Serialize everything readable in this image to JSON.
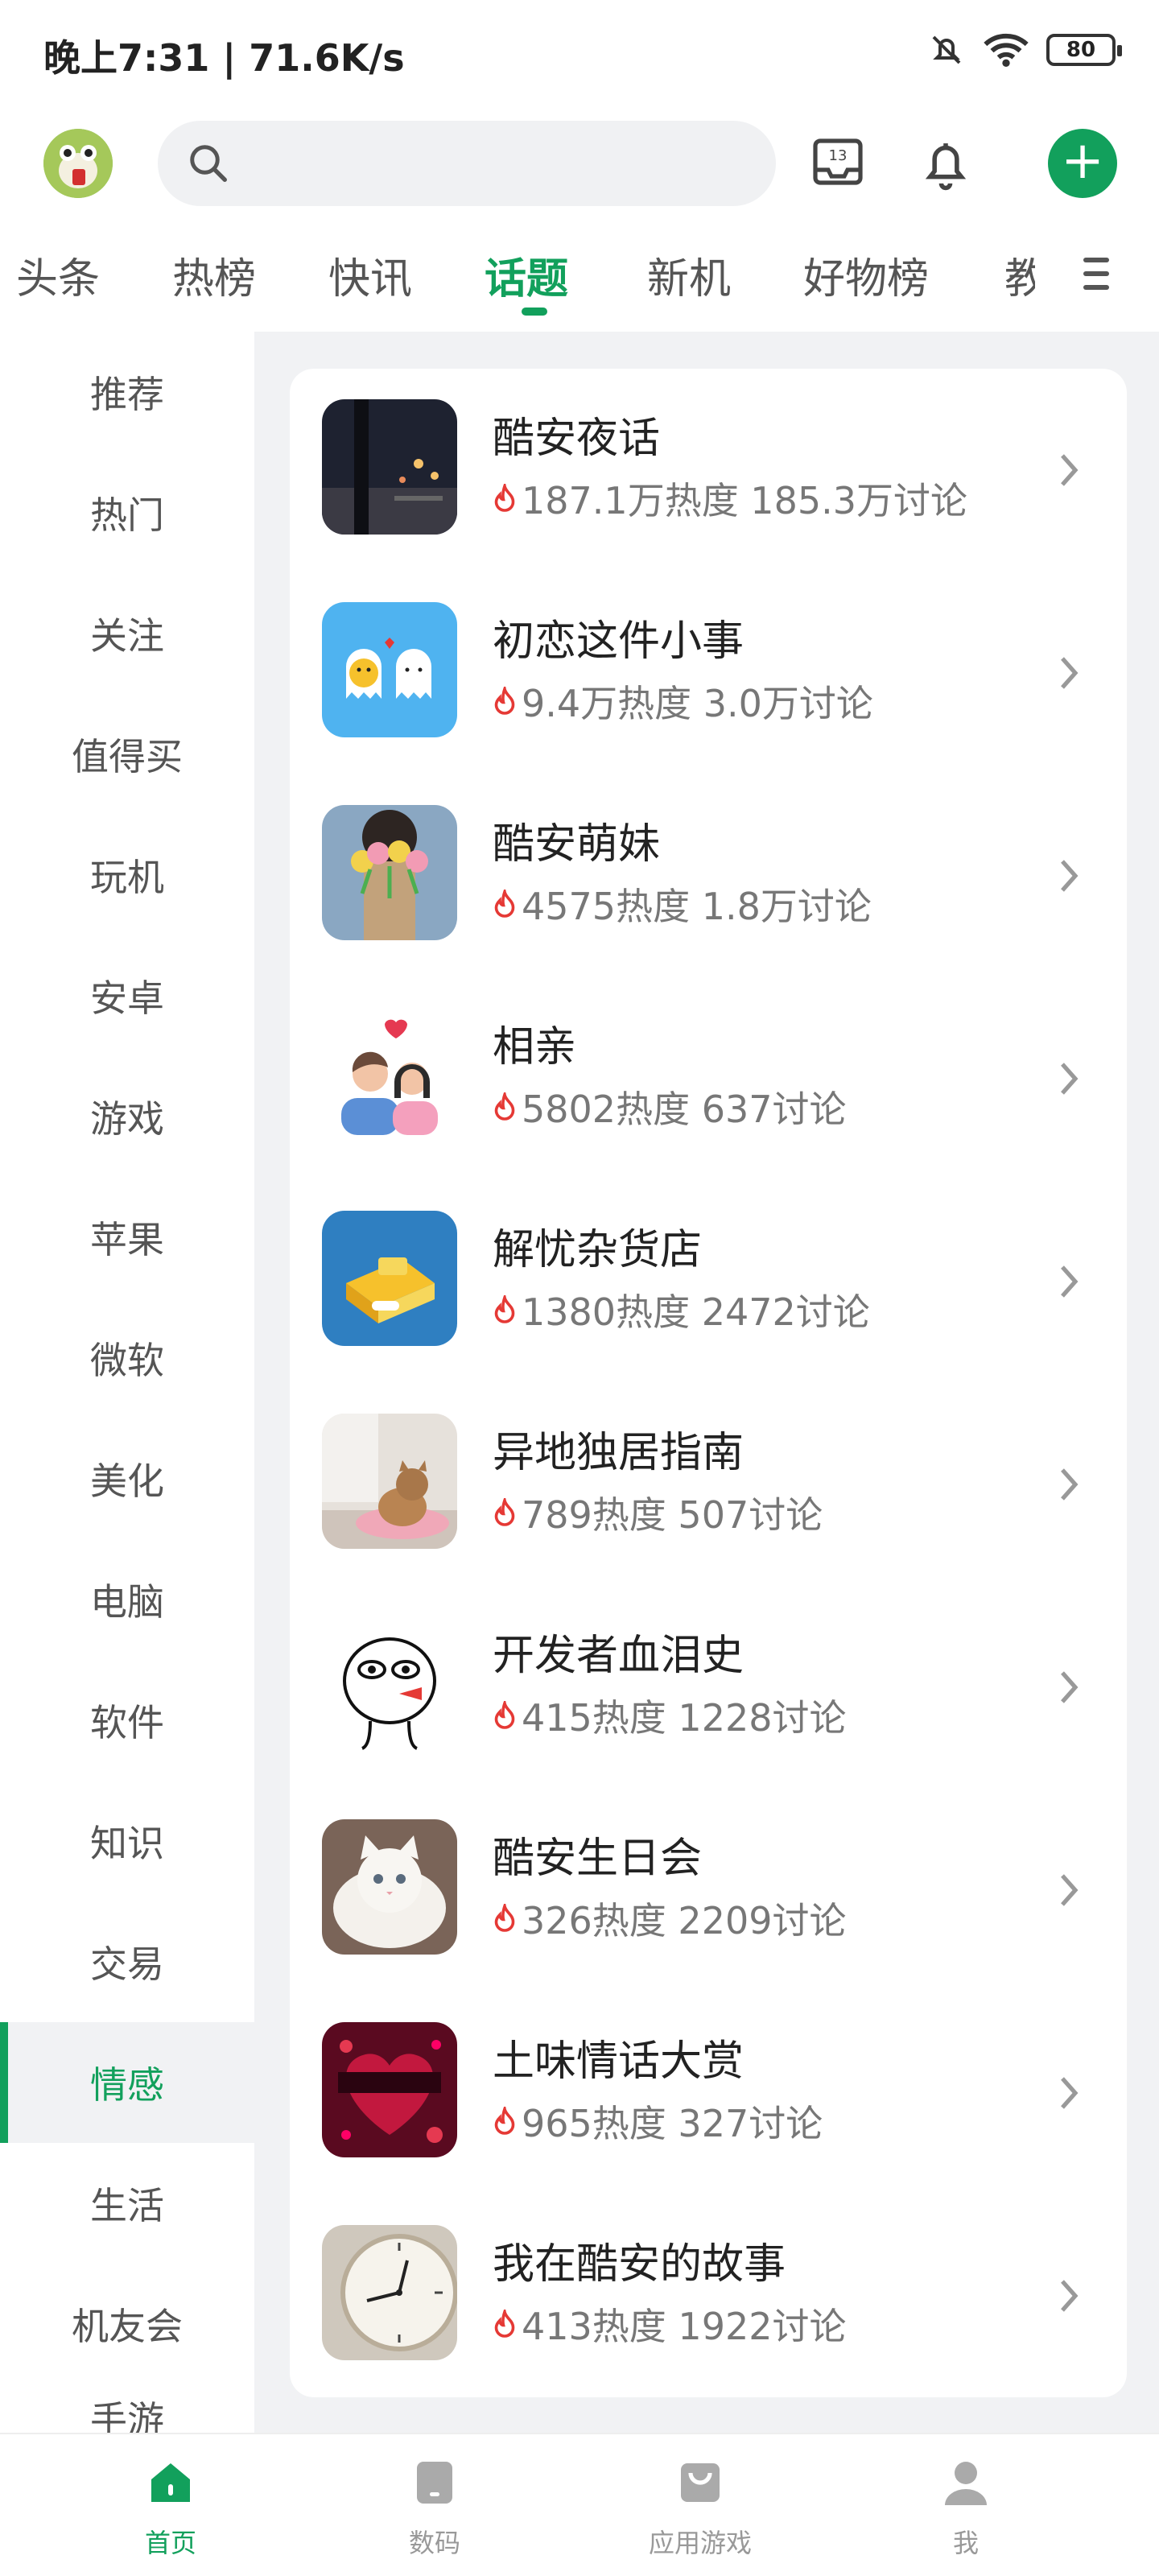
{
  "status_bar": {
    "time_speed": "晚上7:31 | 71.6K/s",
    "battery": "80"
  },
  "header": {
    "inbox_badge": "13"
  },
  "tabs": [
    {
      "label": "头条"
    },
    {
      "label": "热榜"
    },
    {
      "label": "快讯"
    },
    {
      "label": "话题",
      "active": true
    },
    {
      "label": "新机"
    },
    {
      "label": "好物榜"
    },
    {
      "label": "教"
    }
  ],
  "sidebar": {
    "items": [
      {
        "label": "推荐"
      },
      {
        "label": "热门"
      },
      {
        "label": "关注"
      },
      {
        "label": "值得买"
      },
      {
        "label": "玩机"
      },
      {
        "label": "安卓"
      },
      {
        "label": "游戏"
      },
      {
        "label": "苹果"
      },
      {
        "label": "微软"
      },
      {
        "label": "美化"
      },
      {
        "label": "电脑"
      },
      {
        "label": "软件"
      },
      {
        "label": "知识"
      },
      {
        "label": "交易"
      },
      {
        "label": "情感",
        "active": true
      },
      {
        "label": "生活"
      },
      {
        "label": "机友会"
      },
      {
        "label": "手游"
      }
    ]
  },
  "topics": [
    {
      "title": "酷安夜话",
      "stats": "187.1万热度 185.3万讨论",
      "thumb": "night-street",
      "color": "#2b2f3a"
    },
    {
      "title": "初恋这件小事",
      "stats": "9.4万热度 3.0万讨论",
      "thumb": "ghost-couple",
      "color": "#4fb3f0"
    },
    {
      "title": "酷安萌妹",
      "stats": "4575热度 1.8万讨论",
      "thumb": "girl-flowers",
      "color": "#8aa7c2"
    },
    {
      "title": "相亲",
      "stats": "5802热度 637讨论",
      "thumb": "couple-heart",
      "color": "#ffffff"
    },
    {
      "title": "解忧杂货店",
      "stats": "1380热度 2472讨论",
      "thumb": "yellow-box",
      "color": "#2f7fc1"
    },
    {
      "title": "异地独居指南",
      "stats": "789热度 507讨论",
      "thumb": "cat-room",
      "color": "#d8d0c8"
    },
    {
      "title": "开发者血泪史",
      "stats": "415热度 1228讨论",
      "thumb": "sad-face",
      "color": "#ffffff"
    },
    {
      "title": "酷安生日会",
      "stats": "326热度 2209讨论",
      "thumb": "white-cat",
      "color": "#8c7a70"
    },
    {
      "title": "土味情话大赏",
      "stats": "965热度 327讨论",
      "thumb": "hello-ladies",
      "color": "#7a0f2a"
    },
    {
      "title": "我在酷安的故事",
      "stats": "413热度 1922讨论",
      "thumb": "clock",
      "color": "#cfc8bd"
    }
  ],
  "bottom_nav": [
    {
      "label": "首页",
      "active": true
    },
    {
      "label": "数码"
    },
    {
      "label": "应用游戏"
    },
    {
      "label": "我"
    }
  ],
  "colors": {
    "accent": "#12a05c",
    "fire": "#e53935"
  }
}
